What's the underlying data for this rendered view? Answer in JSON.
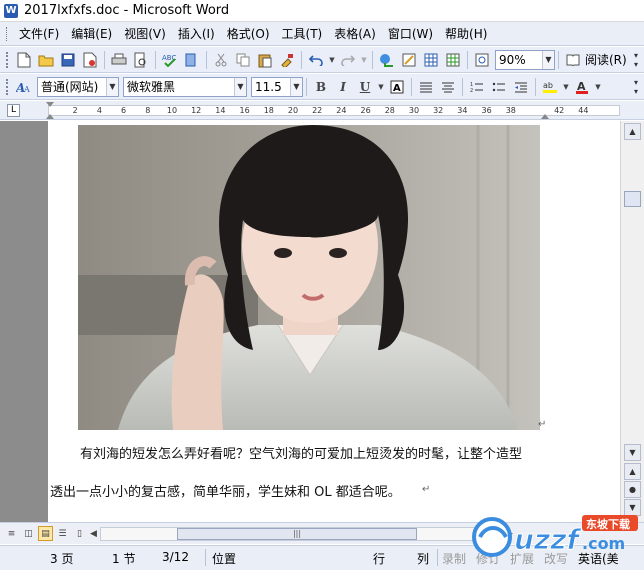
{
  "window": {
    "title": "2017lxfxfs.doc - Microsoft Word"
  },
  "menu": [
    {
      "label": "文件(F)"
    },
    {
      "label": "编辑(E)"
    },
    {
      "label": "视图(V)"
    },
    {
      "label": "插入(I)"
    },
    {
      "label": "格式(O)"
    },
    {
      "label": "工具(T)"
    },
    {
      "label": "表格(A)"
    },
    {
      "label": "窗口(W)"
    },
    {
      "label": "帮助(H)"
    }
  ],
  "toolbar": {
    "zoom": "90%",
    "reading_label": "阅读(R)"
  },
  "format": {
    "style": "普通(网站)",
    "font": "微软雅黑",
    "size": "11.5"
  },
  "ruler": {
    "ticks": [
      "2",
      "4",
      "6",
      "8",
      "10",
      "12",
      "14",
      "16",
      "18",
      "20",
      "22",
      "24",
      "26",
      "28",
      "30",
      "32",
      "34",
      "36",
      "38",
      "42",
      "44"
    ]
  },
  "document": {
    "para_line1": "有刘海的短发怎么弄好看呢？空气刘海的可爱加上短烫发的时髦，让整个造型",
    "para_line2": "透出一点小小的复古感，简单华丽，学生妹和 OL 都适合呢。"
  },
  "status": {
    "page": "3 页",
    "section": "1 节",
    "pages": "3/12",
    "position": "位置",
    "line": "行",
    "column": "列",
    "record": "录制",
    "revise": "修订",
    "extend": "扩展",
    "overwrite": "改写",
    "language": "英语(美"
  },
  "watermark": {
    "brand": "uzzf.com",
    "tag": "东坡下载"
  },
  "colors": {
    "accent": "#2a5db0",
    "toolbar_bg": "#e9eef8"
  }
}
